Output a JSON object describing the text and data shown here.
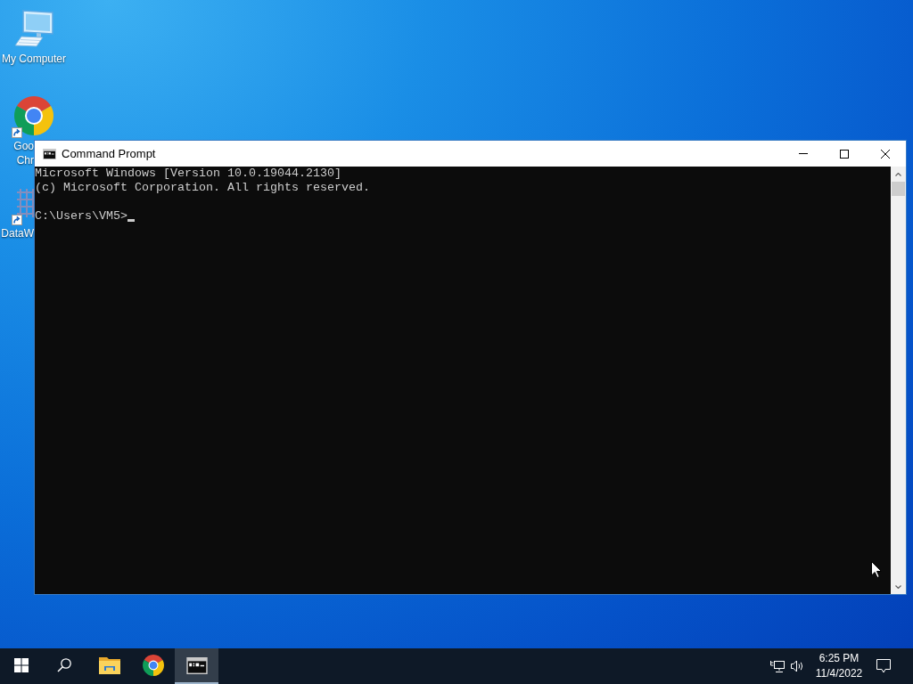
{
  "desktop": {
    "icons": [
      {
        "kind": "computer",
        "label_lines": [
          "My Computer"
        ],
        "shortcut": false
      },
      {
        "kind": "chrome",
        "label_lines": [
          "Goo",
          "Chr"
        ],
        "shortcut": true
      },
      {
        "kind": "grid",
        "label_lines": [
          "DataW"
        ],
        "shortcut": true
      }
    ]
  },
  "window": {
    "title": "Command Prompt",
    "console": {
      "output_lines": [
        "Microsoft Windows [Version 10.0.19044.2130]",
        "(c) Microsoft Corporation. All rights reserved."
      ],
      "prompt": "C:\\Users\\VM5>"
    }
  },
  "taskbar": {
    "items": [
      {
        "kind": "start",
        "selected": false
      },
      {
        "kind": "search",
        "selected": false
      },
      {
        "kind": "explorer",
        "selected": false
      },
      {
        "kind": "chrome",
        "selected": false
      },
      {
        "kind": "terminal",
        "selected": true
      }
    ],
    "clock": {
      "time": "6:25 PM",
      "date": "11/4/2022"
    }
  }
}
